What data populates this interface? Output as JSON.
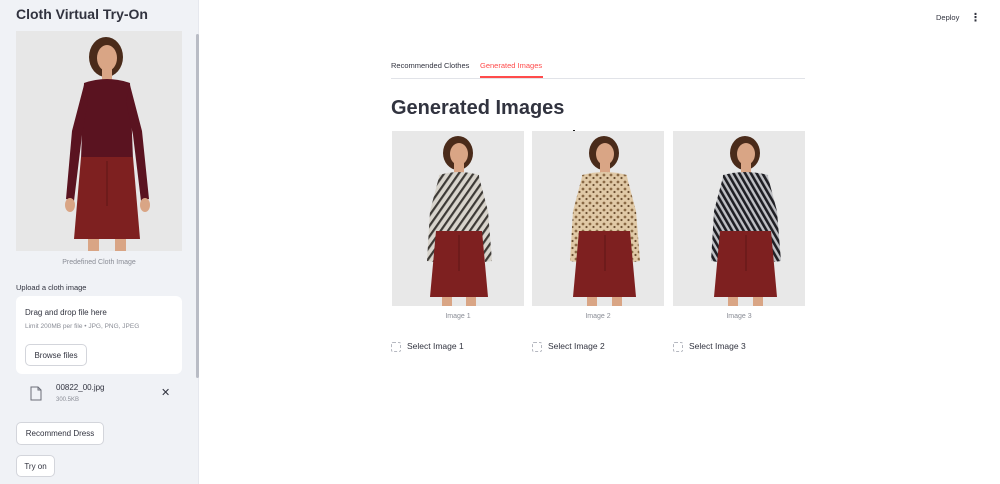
{
  "sidebar": {
    "title": "Cloth Virtual Try-On",
    "predefined_caption": "Predefined Cloth Image",
    "upload_label": "Upload a cloth image",
    "dropzone": {
      "title": "Drag and drop file here",
      "limit": "Limit 200MB per file • JPG, PNG, JPEG",
      "browse_label": "Browse files"
    },
    "uploaded_file": {
      "name": "00822_00.jpg",
      "size": "300.5KB"
    },
    "recommend_label": "Recommend Dress",
    "tryon_label": "Try on"
  },
  "header": {
    "deploy_label": "Deploy",
    "menu_glyph": "⋮"
  },
  "tabs": [
    {
      "label": "Recommended Clothes",
      "active": false
    },
    {
      "label": "Generated Images",
      "active": true
    }
  ],
  "main": {
    "heading": "Generated Images",
    "images": [
      {
        "caption": "Image 1",
        "select_label": "Select Image 1",
        "pattern": "zebra-grey"
      },
      {
        "caption": "Image 2",
        "select_label": "Select Image 2",
        "pattern": "leopard-beige"
      },
      {
        "caption": "Image 3",
        "select_label": "Select Image 3",
        "pattern": "zebra-dark"
      }
    ]
  },
  "colors": {
    "accent": "#ff4b4b",
    "sidebar_bg": "#f0f2f6",
    "text": "#31333f",
    "top_maroon": "#5a1320",
    "skirt": "#7e2020",
    "skin": "#d9a585",
    "hair": "#4a2b1a"
  }
}
